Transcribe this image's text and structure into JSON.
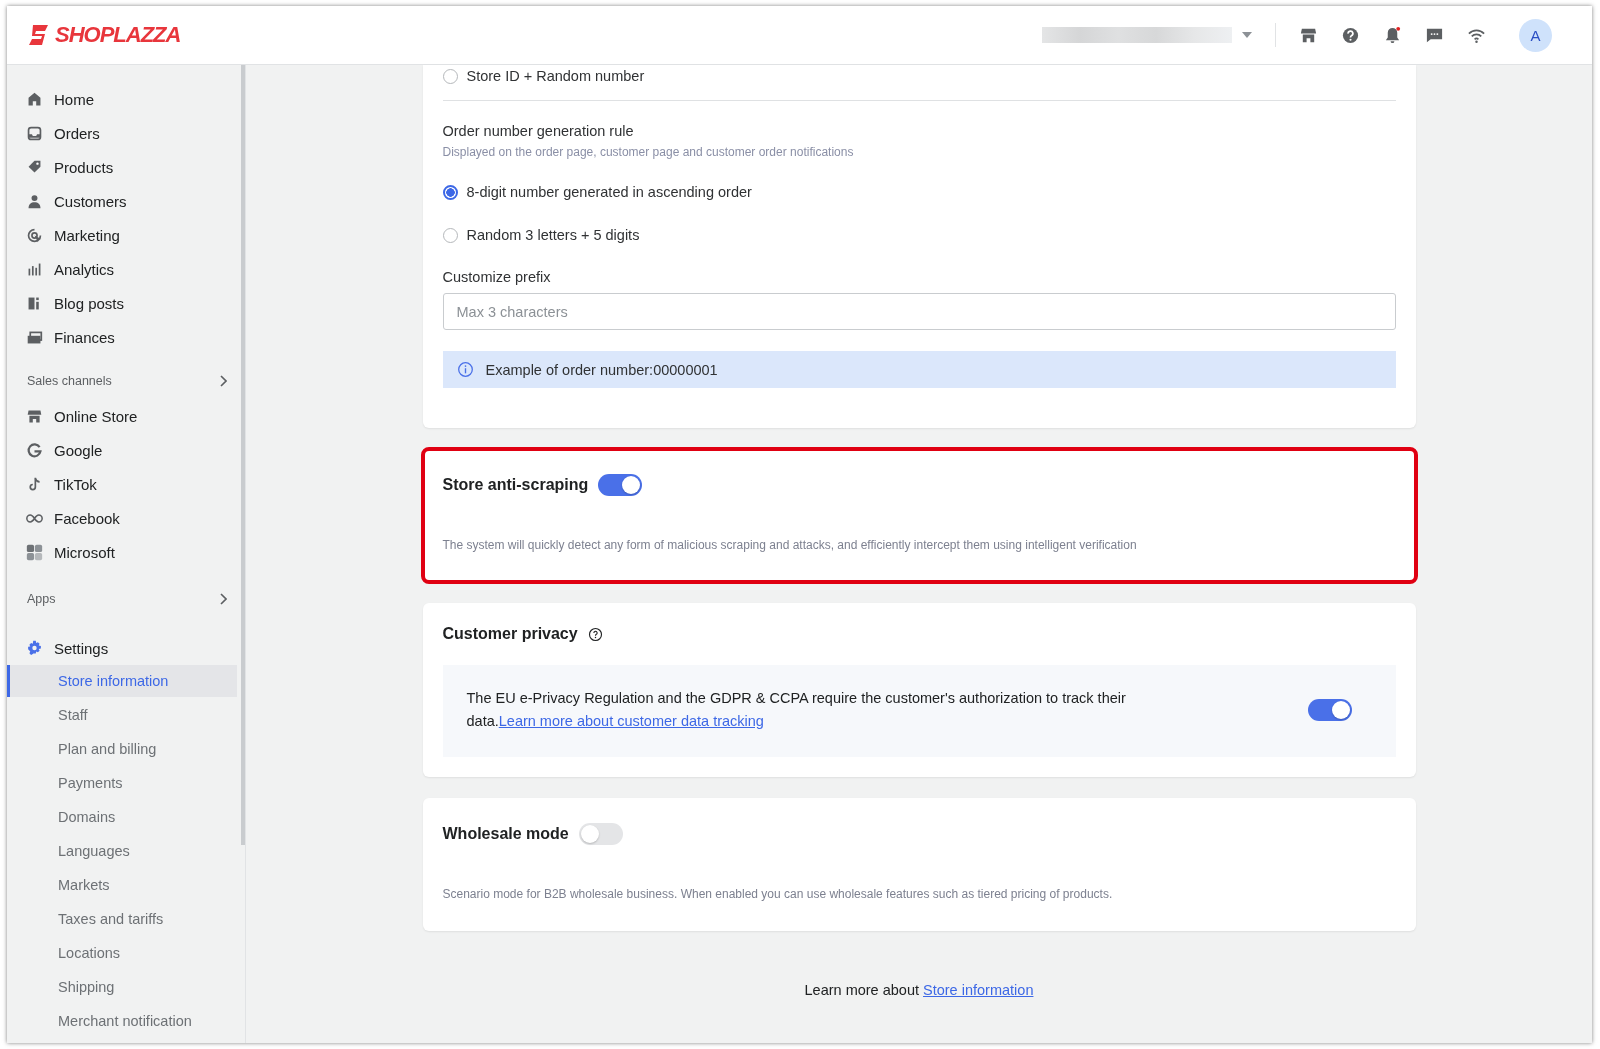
{
  "header": {
    "logo": "SHOPLAZZA",
    "notification_dot": true,
    "avatar": "A"
  },
  "sidebar": {
    "main_items": [
      {
        "label": "Home"
      },
      {
        "label": "Orders"
      },
      {
        "label": "Products"
      },
      {
        "label": "Customers"
      },
      {
        "label": "Marketing"
      },
      {
        "label": "Analytics"
      },
      {
        "label": "Blog posts"
      },
      {
        "label": "Finances"
      }
    ],
    "sales_channels": {
      "label": "Sales channels",
      "items": [
        {
          "label": "Online Store"
        },
        {
          "label": "Google"
        },
        {
          "label": "TikTok"
        },
        {
          "label": "Facebook"
        },
        {
          "label": "Microsoft"
        }
      ]
    },
    "apps": {
      "label": "Apps"
    },
    "settings": {
      "label": "Settings",
      "items": [
        {
          "label": "Store information",
          "selected": true
        },
        {
          "label": "Staff",
          "selected": false
        },
        {
          "label": "Plan and billing",
          "selected": false
        },
        {
          "label": "Payments",
          "selected": false
        },
        {
          "label": "Domains",
          "selected": false
        },
        {
          "label": "Languages",
          "selected": false
        },
        {
          "label": "Markets",
          "selected": false
        },
        {
          "label": "Taxes and tariffs",
          "selected": false
        },
        {
          "label": "Locations",
          "selected": false
        },
        {
          "label": "Shipping",
          "selected": false
        },
        {
          "label": "Merchant notification",
          "selected": false
        }
      ]
    }
  },
  "order_card": {
    "top_options": [
      {
        "label": "Store ID + Random number",
        "selected": false
      }
    ],
    "rule": {
      "title": "Order number generation rule",
      "hint": "Displayed on the order page, customer page and customer order notifications",
      "options": [
        {
          "label": "8-digit number generated in ascending order",
          "selected": true
        },
        {
          "label": "Random 3 letters + 5 digits",
          "selected": false
        }
      ]
    },
    "prefix": {
      "label": "Customize prefix",
      "placeholder": "Max 3 characters"
    },
    "example": "Example of order number:00000001"
  },
  "anti_scraping": {
    "title": "Store anti-scraping",
    "on": true,
    "highlighted": true,
    "description": "The system will quickly detect any form of malicious scraping and attacks, and efficiently intercept them using intelligent verification"
  },
  "privacy": {
    "title": "Customer privacy",
    "text": "The EU e-Privacy Regulation and the GDPR & CCPA require the customer's authorization to track their data.",
    "link": "Learn more about customer data tracking",
    "on": true
  },
  "wholesale": {
    "title": "Wholesale mode",
    "on": false,
    "description": "Scenario mode for B2B wholesale business. When enabled you can use wholesale features such as tiered pricing of products."
  },
  "footer": {
    "text": "Learn more about",
    "link": "Store information"
  }
}
